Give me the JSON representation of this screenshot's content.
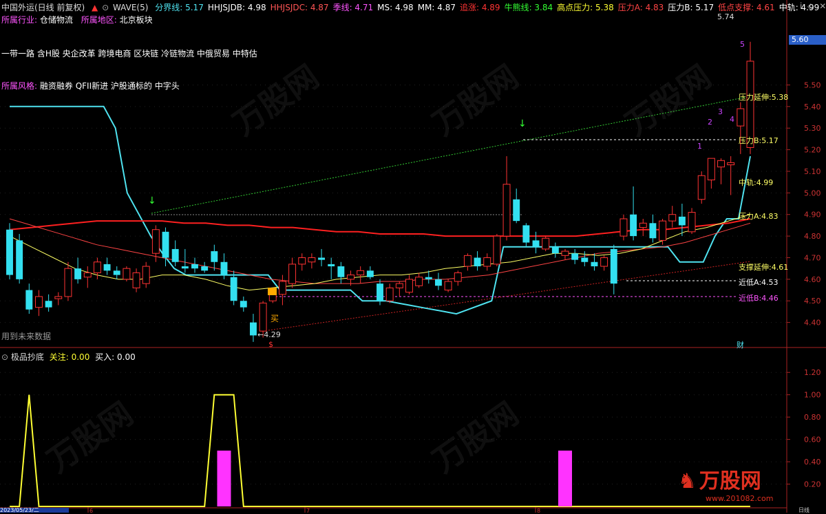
{
  "header": {
    "stock_name": "中国外运(日线 前复权)",
    "indicator": "WAVE(5)",
    "items": [
      {
        "label": "分界线:",
        "value": "5.17",
        "color": "#4fe3f0"
      },
      {
        "label": "HHJSJDB:",
        "value": "4.98",
        "color": "#ffffff"
      },
      {
        "label": "HHJSJDC:",
        "value": "4.87",
        "color": "#ff5555"
      },
      {
        "label": "季线:",
        "value": "4.71",
        "color": "#ff55ff"
      },
      {
        "label": "MS:",
        "value": "4.98",
        "color": "#ffffff"
      },
      {
        "label": "MM:",
        "value": "4.87",
        "color": "#ffffff"
      },
      {
        "label": "追涨:",
        "value": "4.89",
        "color": "#ff3333"
      },
      {
        "label": "牛熊线:",
        "value": "3.84",
        "color": "#33ff33"
      },
      {
        "label": "高点压力:",
        "value": "5.38",
        "color": "#ffff33"
      },
      {
        "label": "压力A:",
        "value": "4.83",
        "color": "#ff4444"
      },
      {
        "label": "压力B:",
        "value": "5.17",
        "color": "#ffffff"
      },
      {
        "label": "低点支撑:",
        "value": "4.61",
        "color": "#ff4444"
      },
      {
        "label": "中轨:",
        "value": "4.99",
        "color": "#ffffff"
      }
    ]
  },
  "info": {
    "industry_label": "所属行业:",
    "industry_value": "仓储物流",
    "region_label": "所属地区:",
    "region_value": "北京板块",
    "concepts": "一带一路 含H股 央企改革 跨境电商 区块链 冷链物流 中俄贸易 中特估",
    "style_label": "所属风格:",
    "style_value": "融资融券 QFII新进 沪股通标的 中字头"
  },
  "annotations": {
    "high_price": "5.74",
    "low_price": "4.29",
    "buy_label": "买",
    "future_data": "用到未来数据",
    "s_mark": "$",
    "fin_mark": "财",
    "price_badge": "5.60",
    "right_labels": [
      {
        "text": "压力延伸:5.38",
        "color": "#ffff66"
      },
      {
        "text": "压力B:5.17",
        "color": "#ffff66"
      },
      {
        "text": "中轨:4.99",
        "color": "#ffff66"
      },
      {
        "text": "压力A:4.83",
        "color": "#ffff66"
      },
      {
        "text": "支撑延伸:4.61",
        "color": "#ffff66"
      },
      {
        "text": "近低A:4.53",
        "color": "#ffffff"
      },
      {
        "text": "近低B:4.46",
        "color": "#ff55ff"
      }
    ],
    "wave_numbers": [
      "1",
      "2",
      "3",
      "4",
      "5"
    ]
  },
  "sub_header": {
    "name": "极品抄底",
    "focus_label": "关注:",
    "focus_value": "0.00",
    "buy_label": "买入:",
    "buy_value": "0.00"
  },
  "bottom": {
    "date": "2023/05/23/二",
    "ticks": [
      "6",
      "7",
      "8"
    ],
    "period": "日线"
  },
  "watermark": {
    "text": "万股网",
    "url": "www.201082.com"
  },
  "colors": {
    "up": "#ff3333",
    "down": "#33e0f0",
    "bg": "#000000",
    "axis": "#aa2222"
  },
  "chart_data": {
    "type": "candlestick",
    "price_ylim": [
      4.3,
      5.75
    ],
    "price_ticks": [
      "5.50",
      "5.40",
      "5.30",
      "5.20",
      "5.10",
      "5.00",
      "4.90",
      "4.80",
      "4.70",
      "4.60",
      "4.50",
      "4.40"
    ],
    "sub_ylim": [
      0,
      1.3
    ],
    "sub_ticks": [
      "1.20",
      "1.00",
      "0.80",
      "0.60",
      "0.40",
      "0.20"
    ],
    "candles": [
      [
        4.83,
        4.86,
        4.6,
        4.62
      ],
      [
        4.78,
        4.81,
        4.58,
        4.6
      ],
      [
        4.55,
        4.58,
        4.44,
        4.46
      ],
      [
        4.47,
        4.55,
        4.43,
        4.52
      ],
      [
        4.5,
        4.53,
        4.45,
        4.47
      ],
      [
        4.51,
        4.54,
        4.48,
        4.52
      ],
      [
        4.52,
        4.68,
        4.5,
        4.65
      ],
      [
        4.65,
        4.7,
        4.58,
        4.6
      ],
      [
        4.61,
        4.66,
        4.56,
        4.63
      ],
      [
        4.63,
        4.7,
        4.6,
        4.68
      ],
      [
        4.67,
        4.7,
        4.62,
        4.64
      ],
      [
        4.64,
        4.66,
        4.6,
        4.62
      ],
      [
        4.6,
        4.66,
        4.59,
        4.65
      ],
      [
        4.56,
        4.65,
        4.54,
        4.63
      ],
      [
        4.58,
        4.68,
        4.56,
        4.66
      ],
      [
        4.72,
        4.85,
        4.68,
        4.83
      ],
      [
        4.82,
        4.84,
        4.66,
        4.7
      ],
      [
        4.74,
        4.78,
        4.66,
        4.68
      ],
      [
        4.66,
        4.74,
        4.63,
        4.65
      ],
      [
        4.67,
        4.7,
        4.63,
        4.65
      ],
      [
        4.66,
        4.68,
        4.63,
        4.64
      ],
      [
        4.73,
        4.76,
        4.64,
        4.68
      ],
      [
        4.68,
        4.72,
        4.6,
        4.62
      ],
      [
        4.61,
        4.64,
        4.48,
        4.5
      ],
      [
        4.5,
        4.52,
        4.45,
        4.47
      ],
      [
        4.4,
        4.44,
        4.31,
        4.34
      ],
      [
        4.36,
        4.5,
        4.33,
        4.49
      ],
      [
        4.5,
        4.55,
        4.49,
        4.53
      ],
      [
        4.53,
        4.62,
        4.48,
        4.59
      ],
      [
        4.58,
        4.7,
        4.56,
        4.67
      ],
      [
        4.67,
        4.72,
        4.64,
        4.7
      ],
      [
        4.68,
        4.72,
        4.65,
        4.7
      ],
      [
        4.7,
        4.74,
        4.66,
        4.69
      ],
      [
        4.67,
        4.7,
        4.6,
        4.66
      ],
      [
        4.66,
        4.68,
        4.58,
        4.61
      ],
      [
        4.6,
        4.64,
        4.57,
        4.62
      ],
      [
        4.62,
        4.66,
        4.58,
        4.64
      ],
      [
        4.64,
        4.66,
        4.6,
        4.61
      ],
      [
        4.58,
        4.6,
        4.48,
        4.5
      ],
      [
        4.5,
        4.58,
        4.49,
        4.56
      ],
      [
        4.56,
        4.59,
        4.52,
        4.58
      ],
      [
        4.54,
        4.62,
        4.53,
        4.6
      ],
      [
        4.57,
        4.63,
        4.56,
        4.61
      ],
      [
        4.61,
        4.64,
        4.58,
        4.6
      ],
      [
        4.6,
        4.63,
        4.55,
        4.57
      ],
      [
        4.55,
        4.6,
        4.54,
        4.59
      ],
      [
        4.59,
        4.64,
        4.57,
        4.63
      ],
      [
        4.66,
        4.72,
        4.64,
        4.71
      ],
      [
        4.7,
        4.73,
        4.64,
        4.66
      ],
      [
        4.66,
        4.72,
        4.64,
        4.7
      ],
      [
        4.67,
        4.81,
        4.66,
        4.8
      ],
      [
        4.8,
        5.17,
        4.78,
        5.04
      ],
      [
        4.97,
        5.02,
        4.86,
        4.87
      ],
      [
        4.85,
        4.86,
        4.75,
        4.77
      ],
      [
        4.78,
        4.82,
        4.72,
        4.75
      ],
      [
        4.74,
        4.8,
        4.73,
        4.79
      ],
      [
        4.75,
        4.77,
        4.7,
        4.72
      ],
      [
        4.71,
        4.74,
        4.69,
        4.73
      ],
      [
        4.72,
        4.74,
        4.67,
        4.69
      ],
      [
        4.7,
        4.73,
        4.66,
        4.68
      ],
      [
        4.68,
        4.72,
        4.64,
        4.66
      ],
      [
        4.66,
        4.71,
        4.64,
        4.7
      ],
      [
        4.74,
        4.76,
        4.53,
        4.58
      ],
      [
        4.8,
        4.9,
        4.78,
        4.88
      ],
      [
        4.9,
        5.03,
        4.78,
        4.8
      ],
      [
        4.84,
        4.88,
        4.8,
        4.86
      ],
      [
        4.86,
        4.9,
        4.77,
        4.79
      ],
      [
        4.78,
        4.88,
        4.76,
        4.87
      ],
      [
        4.87,
        4.94,
        4.84,
        4.9
      ],
      [
        4.89,
        4.95,
        4.8,
        4.85
      ],
      [
        4.82,
        4.93,
        4.81,
        4.91
      ],
      [
        4.97,
        5.1,
        4.95,
        5.08
      ],
      [
        5.06,
        5.14,
        5.02,
        5.16
      ],
      [
        5.12,
        5.16,
        5.04,
        5.15
      ],
      [
        5.13,
        5.17,
        4.99,
        5.14
      ],
      [
        5.31,
        5.42,
        5.18,
        5.39
      ],
      [
        5.21,
        5.7,
        5.18,
        5.61
      ]
    ],
    "series": [
      {
        "name": "分界线",
        "values": [
          5.4,
          5.4,
          5.4,
          5.4,
          5.4,
          5.4,
          5.4,
          5.4,
          5.4,
          5.3,
          5.0,
          4.9,
          4.8,
          4.72,
          4.65,
          4.62,
          4.62,
          4.62,
          4.62,
          4.62,
          4.62,
          4.62,
          4.62,
          4.55,
          4.55,
          4.55,
          4.55,
          4.55,
          4.55,
          4.55,
          4.5,
          4.5,
          4.5,
          4.49,
          4.48,
          4.47,
          4.46,
          4.45,
          4.44,
          4.46,
          4.48,
          4.5,
          4.75,
          4.75,
          4.75,
          4.75,
          4.75,
          4.75,
          4.75,
          4.75,
          4.75,
          4.75,
          4.75,
          4.75,
          4.75,
          4.75,
          4.75,
          4.68,
          4.68,
          4.68,
          4.8,
          4.88,
          4.88,
          5.17
        ]
      },
      {
        "name": "MA60",
        "values": [
          4.83,
          4.84,
          4.85,
          4.86,
          4.87,
          4.87,
          4.87,
          4.87,
          4.86,
          4.86,
          4.85,
          4.85,
          4.84,
          4.84,
          4.83,
          4.82,
          4.82,
          4.81,
          4.81,
          4.81,
          4.8,
          4.8,
          4.8,
          4.8,
          4.8,
          4.8,
          4.8,
          4.81,
          4.82,
          4.83,
          4.83,
          4.84,
          4.85,
          4.86,
          4.88
        ]
      },
      {
        "name": "MA20",
        "values": [
          4.88,
          4.85,
          4.82,
          4.79,
          4.76,
          4.74,
          4.72,
          4.7,
          4.68,
          4.66,
          4.64,
          4.62,
          4.6,
          4.59,
          4.58,
          4.58,
          4.58,
          4.59,
          4.59,
          4.6,
          4.6,
          4.61,
          4.62,
          4.64,
          4.66,
          4.68,
          4.7,
          4.72,
          4.73,
          4.74,
          4.75,
          4.77,
          4.8,
          4.83,
          4.86
        ]
      },
      {
        "name": "MA5",
        "values": [
          4.8,
          4.75,
          4.7,
          4.65,
          4.62,
          4.6,
          4.6,
          4.62,
          4.62,
          4.6,
          4.57,
          4.55,
          4.56,
          4.57,
          4.58,
          4.6,
          4.61,
          4.62,
          4.62,
          4.63,
          4.65,
          4.66,
          4.67,
          4.68,
          4.7,
          4.72,
          4.72,
          4.71,
          4.72,
          4.74,
          4.78,
          4.82,
          4.84,
          4.87,
          4.9
        ]
      }
    ],
    "sub_series": [
      {
        "name": "关注",
        "values": [
          0,
          0,
          1,
          0,
          0,
          0,
          0,
          0,
          0,
          0,
          0,
          0,
          0,
          0,
          0,
          0,
          0,
          0,
          0,
          0,
          0,
          1,
          1,
          1,
          0,
          0,
          0,
          0,
          0,
          0,
          0,
          0,
          0,
          0,
          0,
          0,
          0,
          0,
          0,
          0,
          0,
          0,
          0,
          0,
          0,
          0,
          0,
          0,
          0,
          0,
          0,
          0,
          0,
          0,
          0,
          0,
          0,
          0,
          0,
          0,
          0,
          0,
          0,
          0,
          0,
          0,
          0,
          0,
          0,
          0,
          0,
          0,
          0,
          0,
          0,
          0,
          0
        ]
      },
      {
        "name": "买入",
        "values": [
          0,
          0,
          0,
          0,
          0,
          0,
          0,
          0,
          0,
          0,
          0,
          0,
          0,
          0,
          0,
          0,
          0,
          0,
          0,
          0,
          0,
          0,
          0.5,
          0,
          0,
          0,
          0,
          0,
          0,
          0,
          0,
          0,
          0,
          0,
          0,
          0,
          0,
          0,
          0,
          0,
          0,
          0,
          0,
          0,
          0,
          0,
          0,
          0,
          0,
          0,
          0,
          0,
          0,
          0,
          0,
          0,
          0,
          0.5,
          0,
          0,
          0,
          0,
          0,
          0,
          0,
          0,
          0,
          0,
          0,
          0,
          0,
          0,
          0,
          0,
          0,
          0,
          0
        ]
      }
    ]
  }
}
